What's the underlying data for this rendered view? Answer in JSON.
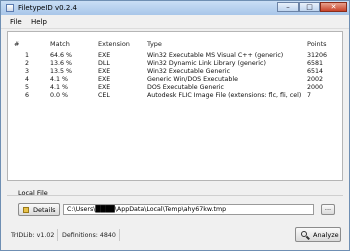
{
  "window": {
    "title": "FiletypeID v0.2.4",
    "controls": {
      "minimize": "–",
      "maximize": "□",
      "close": "✕"
    }
  },
  "menu": [
    "File",
    "Help"
  ],
  "table": {
    "columns": [
      "#",
      "Match",
      "Extension",
      "Type",
      "Points"
    ],
    "rows": [
      {
        "num": "1",
        "match": "64.6 %",
        "ext": "EXE",
        "type": "Win32 Executable MS Visual C++ (generic)",
        "points": "31206"
      },
      {
        "num": "2",
        "match": "13.6 %",
        "ext": "DLL",
        "type": "Win32 Dynamic Link Library (generic)",
        "points": "6581"
      },
      {
        "num": "3",
        "match": "13.5 %",
        "ext": "EXE",
        "type": "Win32 Executable Generic",
        "points": "6514"
      },
      {
        "num": "4",
        "match": "4.1 %",
        "ext": "EXE",
        "type": "Generic Win/DOS Executable",
        "points": "2002"
      },
      {
        "num": "5",
        "match": "4.1 %",
        "ext": "EXE",
        "type": "DOS Executable Generic",
        "points": "2000"
      },
      {
        "num": "6",
        "match": "0.0 %",
        "ext": "CEL",
        "type": "Autodesk FLIC Image File (extensions: flc, fli, cel)",
        "points": "7"
      }
    ]
  },
  "local_file": {
    "label": "Local File",
    "details_label": "Details",
    "path": "C:\\Users\\████\\AppData\\Local\\Temp\\ahy67kw.tmp",
    "browse_label": "..."
  },
  "status": {
    "trid_lib": "TrIDLib:  v1.02",
    "definitions": "Definitions:  4840"
  },
  "analyze_label": "Analyze"
}
